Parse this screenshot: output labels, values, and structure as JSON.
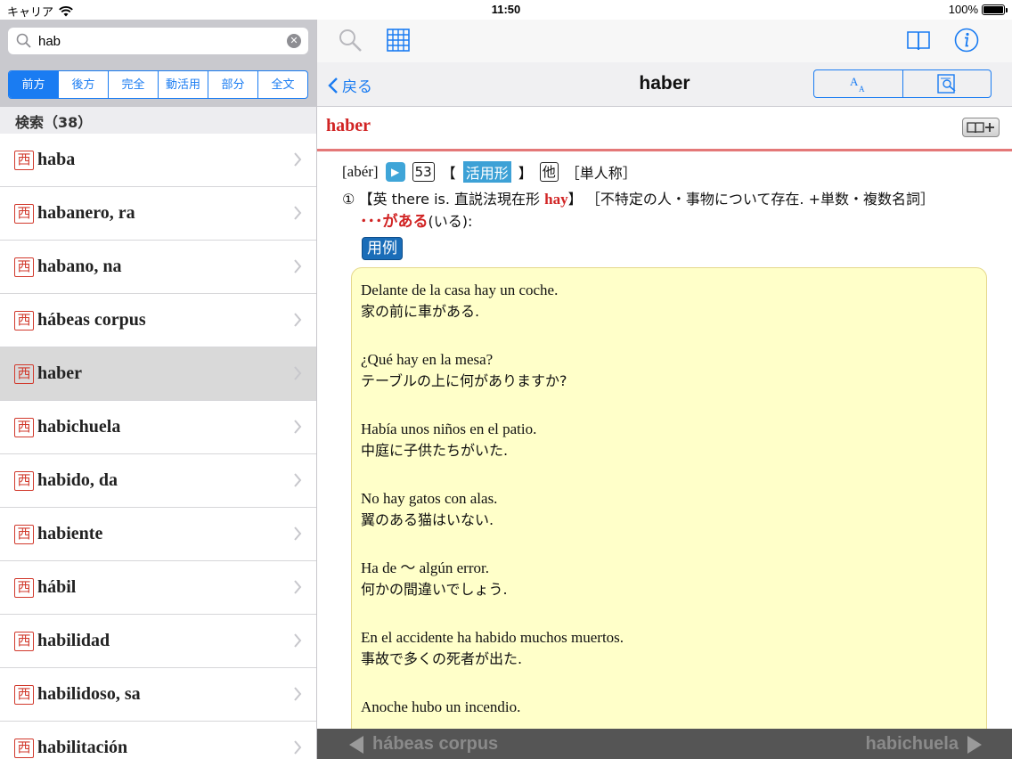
{
  "status": {
    "carrier": "キャリア",
    "time": "11:50",
    "battery": "100%"
  },
  "search": {
    "value": "hab",
    "placeholder": ""
  },
  "modes": [
    "前方",
    "後方",
    "完全",
    "動活用",
    "部分",
    "全文"
  ],
  "results": {
    "header": "検索（38）",
    "badge": "西",
    "items": [
      "haba",
      "habanero, ra",
      "habano, na",
      "hábeas corpus",
      "haber",
      "habichuela",
      "habido, da",
      "habiente",
      "hábil",
      "habilidad",
      "habilidoso, sa",
      "habilitación"
    ],
    "selected_index": 4
  },
  "nav": {
    "back_label": "戻る",
    "title": "haber"
  },
  "entry": {
    "headword": "haber",
    "pron": "[abér]",
    "number": "53",
    "conj_label_open": "【",
    "conj_label": "活用形",
    "conj_label_close": "】",
    "ta": "他",
    "person": "［単人称］",
    "sense_num": "①",
    "sense_en": "【英 there is. 直説法現在形 ",
    "sense_hay": "hay",
    "sense_close": "】",
    "sense_note": "［不特定の人・事物について存在. +単数・複数名詞］",
    "meaning_red": "･･･がある",
    "meaning_rest": "(いる):",
    "yourei": "用例"
  },
  "examples": [
    {
      "es": "Delante de la casa hay un coche.",
      "ja": "家の前に車がある."
    },
    {
      "es": "¿Qué hay en la mesa?",
      "ja": "テーブルの上に何がありますか?"
    },
    {
      "es": "Había unos niños en el patio.",
      "ja": "中庭に子供たちがいた."
    },
    {
      "es": "No hay gatos con alas.",
      "ja": "翼のある猫はいない."
    },
    {
      "es": "Ha de 〜 algún error.",
      "ja": "何かの間違いでしょう."
    },
    {
      "es": "En el accidente ha habido muchos muertos.",
      "ja": "事故で多くの死者が出た."
    },
    {
      "es": "Anoche hubo un incendio.",
      "ja": ""
    }
  ],
  "pager": {
    "prev": "hábeas corpus",
    "next": "habichuela"
  },
  "colors": {
    "accent": "#1a7cf2",
    "headword_red": "#d12424",
    "example_bg": "#ffffc9"
  }
}
